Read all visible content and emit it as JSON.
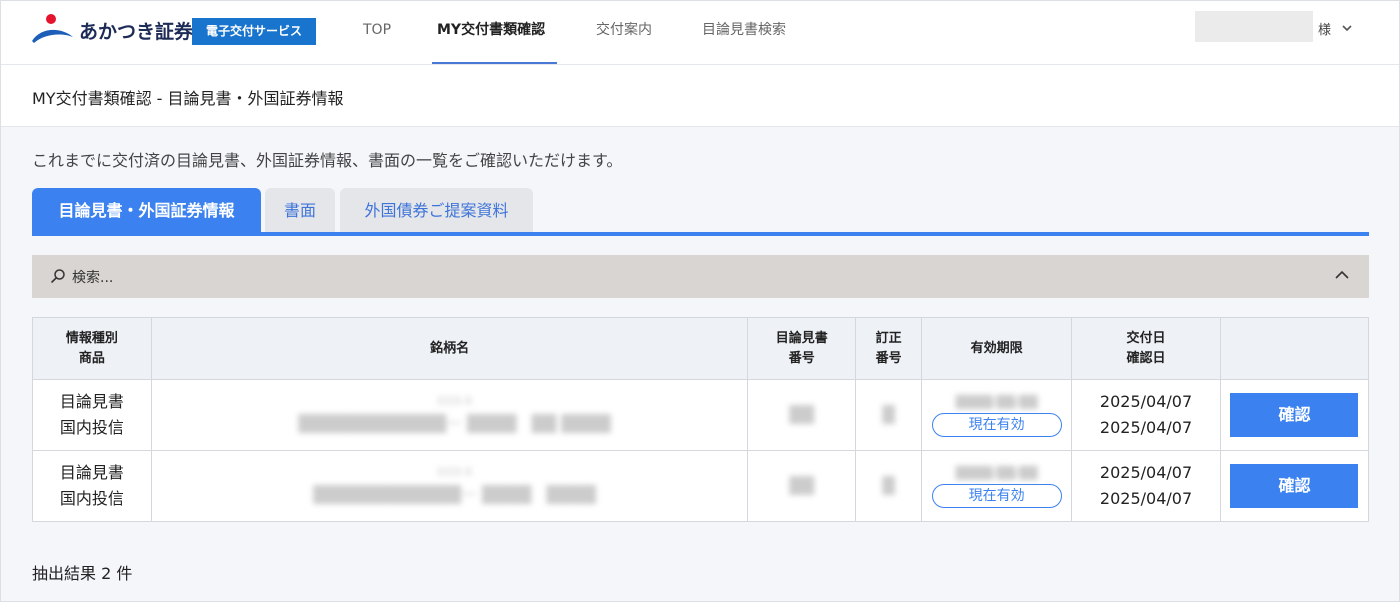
{
  "brand": {
    "name": "あかつき証券",
    "service_badge": "電子交付サービス"
  },
  "nav": {
    "items": [
      {
        "label": "TOP"
      },
      {
        "label": "MY交付書類確認"
      },
      {
        "label": "交付案内"
      },
      {
        "label": "目論見書検索"
      }
    ],
    "active_index": 1
  },
  "user": {
    "suffix": "様"
  },
  "page": {
    "title": "MY交付書類確認 - 目論見書・外国証券情報",
    "intro": "これまでに交付済の目論見書、外国証券情報、書面の一覧をご確認いただけます。"
  },
  "tabs": [
    {
      "label": "目論見書・外国証券情報",
      "active": true
    },
    {
      "label": "書面",
      "active": false
    },
    {
      "label": "外国債券ご提案資料",
      "active": false
    }
  ],
  "search": {
    "label": "検索..."
  },
  "table": {
    "headers": {
      "type_line1": "情報種別",
      "type_line2": "商品",
      "name": "銘柄名",
      "doc_no_line1": "目論見書",
      "doc_no_line2": "番号",
      "rev_line1": "訂正",
      "rev_line2": "番号",
      "validity": "有効期限",
      "date_line1": "交付日",
      "date_line2": "確認日"
    },
    "rows": [
      {
        "info_type": "目論見書",
        "product": "国内投信",
        "name_code": "XXX-X",
        "name_main": "████████████ー ████",
        "name_tag": "██ ████",
        "doc_no": "██",
        "rev_no": "█",
        "expiry": "████/██/██",
        "status": "現在有効",
        "delivery_date": "2025/04/07",
        "confirm_date": "2025/04/07",
        "button": "確認"
      },
      {
        "info_type": "目論見書",
        "product": "国内投信",
        "name_code": "XXX-X",
        "name_main": "████████████ー ████",
        "name_tag": "████",
        "doc_no": "██",
        "rev_no": "█",
        "expiry": "████/██/██",
        "status": "現在有効",
        "delivery_date": "2025/04/07",
        "confirm_date": "2025/04/07",
        "button": "確認"
      }
    ]
  },
  "result_count": "抽出結果 2 件",
  "colors": {
    "primary": "#3b82f0",
    "badge_blue": "#1874cd",
    "logo_red": "#e5142c",
    "search_bg": "#d8d5d2"
  }
}
